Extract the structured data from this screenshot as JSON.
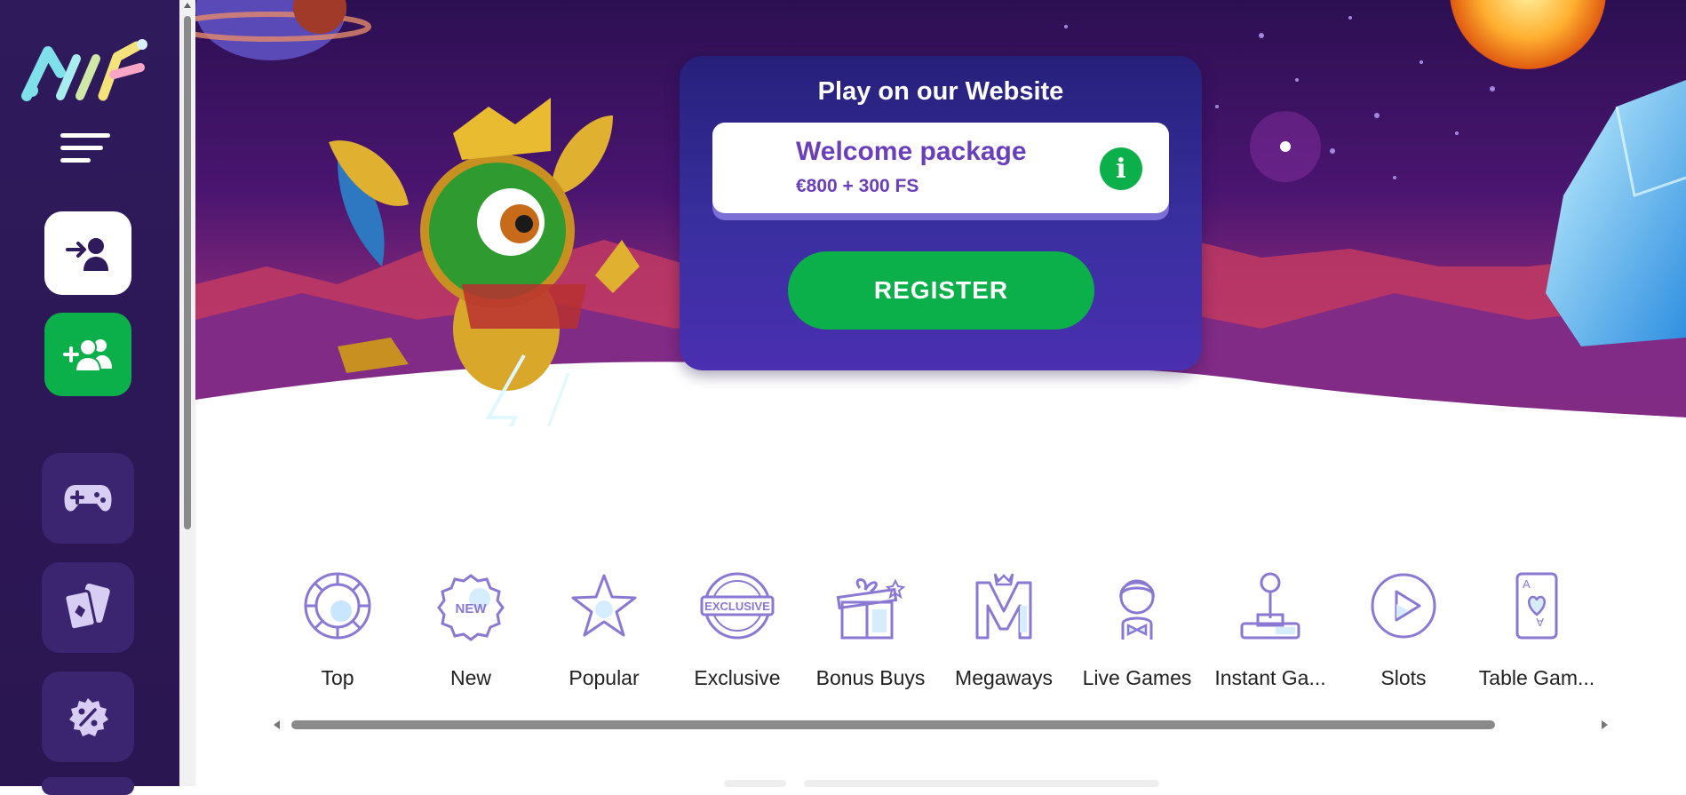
{
  "colors": {
    "sidebar_bg": "#2f1a5c",
    "brand_green": "#0cb04a",
    "promo_purple": "#3a2fa0",
    "welcome_text": "#6a3fb9",
    "category_icon": "#8a78d2"
  },
  "sidebar": {
    "logo_icon": "brand-logo-icon",
    "menu_icon": "hamburger-menu-icon",
    "items": [
      {
        "name": "login",
        "icon": "login-user-icon"
      },
      {
        "name": "register",
        "icon": "add-users-icon"
      },
      {
        "name": "games",
        "icon": "gamepad-icon"
      },
      {
        "name": "cards",
        "icon": "playing-cards-icon"
      },
      {
        "name": "promotions",
        "icon": "percent-badge-icon"
      }
    ]
  },
  "promo": {
    "title": "Play on our Website",
    "welcome_title": "Welcome package",
    "welcome_offer": "€800 + 300 FS",
    "info_label": "i",
    "register_label": "REGISTER"
  },
  "categories": [
    {
      "label": "Top",
      "icon": "chip-icon"
    },
    {
      "label": "New",
      "icon": "new-badge-icon"
    },
    {
      "label": "Popular",
      "icon": "star-icon"
    },
    {
      "label": "Exclusive",
      "icon": "exclusive-seal-icon"
    },
    {
      "label": "Bonus Buys",
      "icon": "gift-box-icon"
    },
    {
      "label": "Megaways",
      "icon": "megaways-m-icon"
    },
    {
      "label": "Live Games",
      "icon": "dealer-icon"
    },
    {
      "label": "Instant Ga...",
      "icon": "joystick-icon"
    },
    {
      "label": "Slots",
      "icon": "play-circle-icon"
    },
    {
      "label": "Table Gam...",
      "icon": "playing-card-icon"
    }
  ],
  "exclusive_badge_text": "EXCLUSIVE",
  "new_badge_text": "NEW"
}
